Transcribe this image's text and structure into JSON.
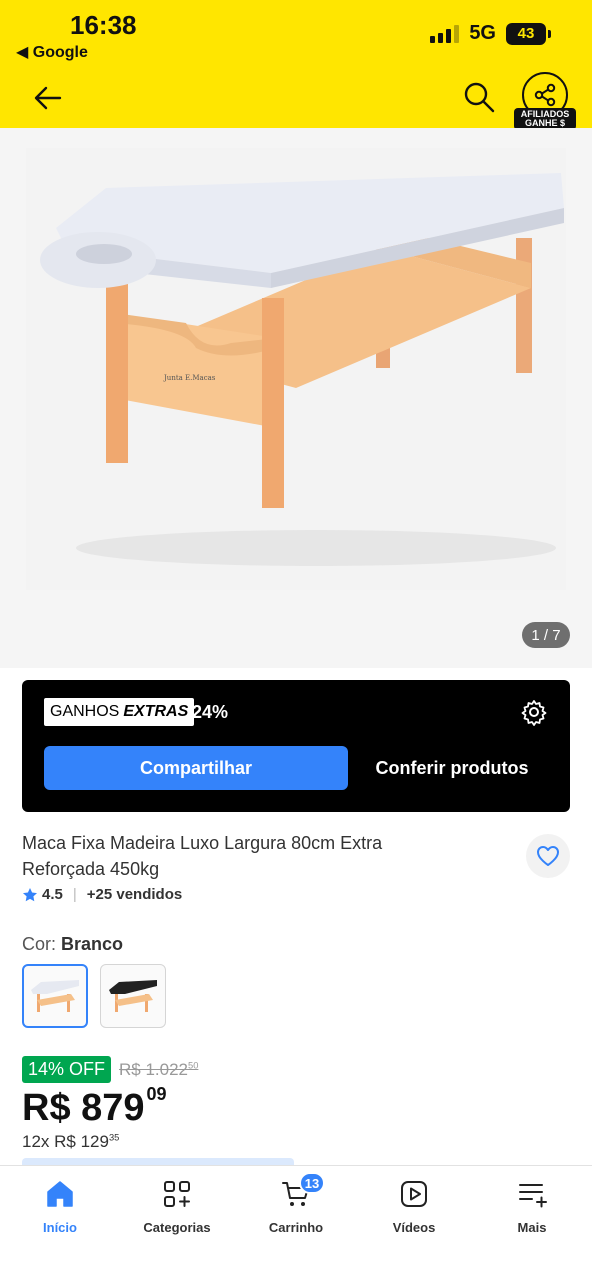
{
  "status_bar": {
    "time": "16:38",
    "back_app": "◀ Google",
    "network": "5G",
    "battery": "43"
  },
  "header": {
    "affiliate_tag_line1": "AFILIADOS",
    "affiliate_tag_line2": "GANHE $",
    "colors": {
      "background": "#ffe600"
    }
  },
  "gallery": {
    "counter": "1 / 7",
    "logo_text": "Junta E.Macas"
  },
  "affiliate_box": {
    "badge_word1": "GANHOS",
    "badge_word2": "EXTRAS",
    "percent": "24%",
    "share_label": "Compartilhar",
    "check_label": "Conferir produtos"
  },
  "product": {
    "title": "Maca Fixa Madeira Luxo Largura 80cm Extra Reforçada 450kg",
    "rating": "4.5",
    "separator": "|",
    "sold": "+25 vendidos",
    "color_label": "Cor: ",
    "color_value": "Branco",
    "swatches": [
      "branco",
      "preto"
    ],
    "discount": "14% OFF",
    "old_price_main": "R$ 1.022",
    "old_price_cents": "50",
    "price_main": "R$ 879",
    "price_cents": "09",
    "installment_main": "12x R$ 129",
    "installment_cents": "35"
  },
  "tabbar": {
    "tabs": [
      {
        "label": "Início",
        "icon": "home-icon",
        "active": true
      },
      {
        "label": "Categorias",
        "icon": "categories-icon"
      },
      {
        "label": "Carrinho",
        "icon": "cart-icon",
        "badge": "13"
      },
      {
        "label": "Vídeos",
        "icon": "video-icon"
      },
      {
        "label": "Mais",
        "icon": "more-icon"
      }
    ],
    "colors": {
      "accent": "#3483fa"
    }
  }
}
